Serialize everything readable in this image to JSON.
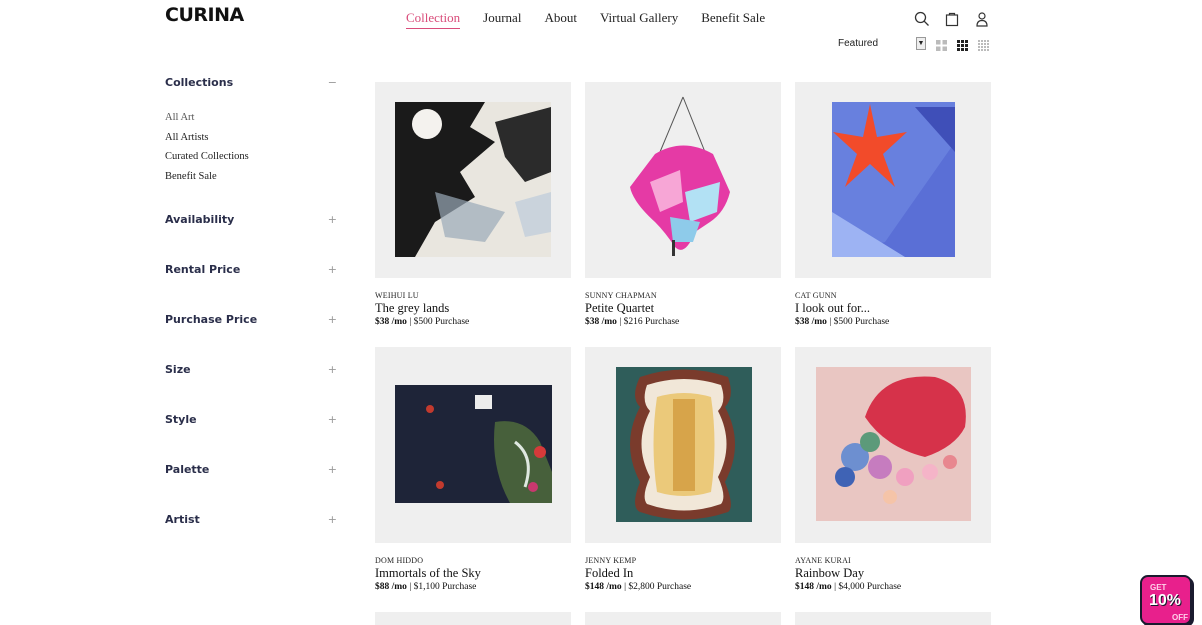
{
  "brand": {
    "logo": "CURINA"
  },
  "nav": [
    {
      "label": "Collection",
      "active": true
    },
    {
      "label": "Journal"
    },
    {
      "label": "About"
    },
    {
      "label": "Virtual Gallery"
    },
    {
      "label": "Benefit Sale"
    }
  ],
  "header_icons": [
    "search-icon",
    "bag-icon",
    "user-icon"
  ],
  "sort": {
    "selected": "Featured"
  },
  "view_toggles": [
    "grid-2-icon",
    "grid-3-icon",
    "grid-4-icon"
  ],
  "sidebar": {
    "collections": {
      "label": "Collections",
      "toggle": "−",
      "items": [
        {
          "label": "All Art",
          "active": true
        },
        {
          "label": "All Artists"
        },
        {
          "label": "Curated Collections"
        },
        {
          "label": "Benefit Sale"
        }
      ]
    },
    "filters": [
      {
        "label": "Availability",
        "toggle": "+"
      },
      {
        "label": "Rental Price",
        "toggle": "+"
      },
      {
        "label": "Purchase Price",
        "toggle": "+"
      },
      {
        "label": "Size",
        "toggle": "+"
      },
      {
        "label": "Style",
        "toggle": "+"
      },
      {
        "label": "Palette",
        "toggle": "+"
      },
      {
        "label": "Artist",
        "toggle": "+"
      }
    ]
  },
  "products": [
    {
      "artist": "WEIHUI LU",
      "title": "The grey lands",
      "rent": "$38 /mo",
      "purchase": " | $500 Purchase"
    },
    {
      "artist": "SUNNY CHAPMAN",
      "title": "Petite Quartet",
      "rent": "$38 /mo",
      "purchase": " | $216 Purchase"
    },
    {
      "artist": "CAT GUNN",
      "title": "I look out for...",
      "rent": "$38 /mo",
      "purchase": " | $500 Purchase"
    },
    {
      "artist": "DOM HIDDO",
      "title": "Immortals of the Sky",
      "rent": "$88 /mo",
      "purchase": " | $1,100 Purchase"
    },
    {
      "artist": "JENNY KEMP",
      "title": "Folded In",
      "rent": "$148 /mo",
      "purchase": " | $2,800 Purchase"
    },
    {
      "artist": "AYANE KURAI",
      "title": "Rainbow Day",
      "rent": "$148 /mo",
      "purchase": " | $4,000 Purchase"
    }
  ],
  "promo_badge": {
    "line1": "GET",
    "line2": "10%",
    "line3": "OFF"
  }
}
